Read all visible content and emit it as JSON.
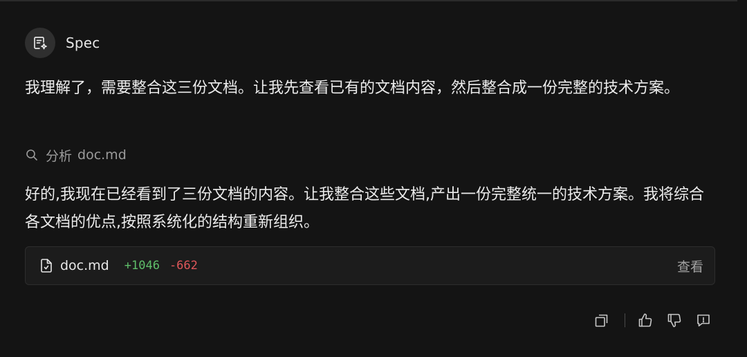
{
  "agent": {
    "name": "Spec",
    "avatar_icon": "spec-document-sparkle-icon"
  },
  "messages": [
    {
      "text": "我理解了，需要整合这三份文档。让我先查看已有的文档内容，然后整合成一份完整的技术方案。"
    },
    {
      "text": "好的,我现在已经看到了三份文档的内容。让我整合这些文档,产出一份完整统一的技术方案。我将综合各文档的优点,按照系统化的结构重新组织。"
    }
  ],
  "tool_call": {
    "icon": "search-icon",
    "action": "分析",
    "target": "doc.md"
  },
  "file_change": {
    "icon": "file-edit-icon",
    "file_name": "doc.md",
    "added": "+1046",
    "removed": "-662",
    "view_label": "查看"
  },
  "actions": [
    {
      "icon": "copy-icon"
    },
    {
      "icon": "thumbs-up-icon"
    },
    {
      "icon": "thumbs-down-icon"
    },
    {
      "icon": "report-icon"
    }
  ],
  "colors": {
    "background": "#141414",
    "card_background": "#1c1c1c",
    "added": "#5fbf6a",
    "removed": "#e0575a",
    "muted_text": "#9b9b9b"
  }
}
